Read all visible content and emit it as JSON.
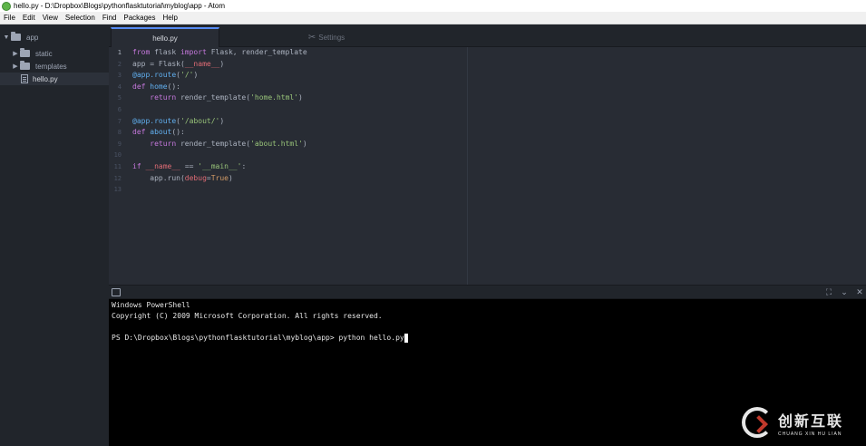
{
  "window": {
    "title": "hello.py - D:\\Dropbox\\Blogs\\pythonflasktutorial\\myblog\\app - Atom"
  },
  "menu": [
    "File",
    "Edit",
    "View",
    "Selection",
    "Find",
    "Packages",
    "Help"
  ],
  "tree": {
    "root": "app",
    "items": [
      {
        "label": "static",
        "type": "folder"
      },
      {
        "label": "templates",
        "type": "folder"
      },
      {
        "label": "hello.py",
        "type": "file",
        "selected": true
      }
    ]
  },
  "tabs": [
    {
      "label": "hello.py",
      "active": true
    },
    {
      "label": "Settings",
      "active": false,
      "icon": "wrench-icon"
    }
  ],
  "editor": {
    "current_line": 1,
    "line_numbers": [
      "1",
      "2",
      "3",
      "4",
      "5",
      "6",
      "7",
      "8",
      "9",
      "10",
      "11",
      "12",
      "13"
    ],
    "lines": [
      "from flask import Flask, render_template",
      "app = Flask(__name__)",
      "@app.route('/')",
      "def home():",
      "    return render_template('home.html')",
      "",
      "@app.route('/about/')",
      "def about():",
      "    return render_template('about.html')",
      "",
      "if __name__ == '__main__':",
      "    app.run(debug=True)",
      ""
    ]
  },
  "terminal": {
    "lines": [
      "Windows PowerShell",
      "Copyright (C) 2009 Microsoft Corporation. All rights reserved.",
      "",
      "PS D:\\Dropbox\\Blogs\\pythonflasktutorial\\myblog\\app> python hello.py"
    ],
    "icons": [
      "keyboard-icon",
      "maximize-icon",
      "collapse-icon",
      "close-icon"
    ]
  },
  "watermark": {
    "main": "创新互联",
    "sub": "CHUANG XIN HU LIAN"
  },
  "colors": {
    "accent": "#568af2",
    "editor_bg": "#282c34",
    "sidebar_bg": "#21252b",
    "terminal_bg": "#000000"
  }
}
